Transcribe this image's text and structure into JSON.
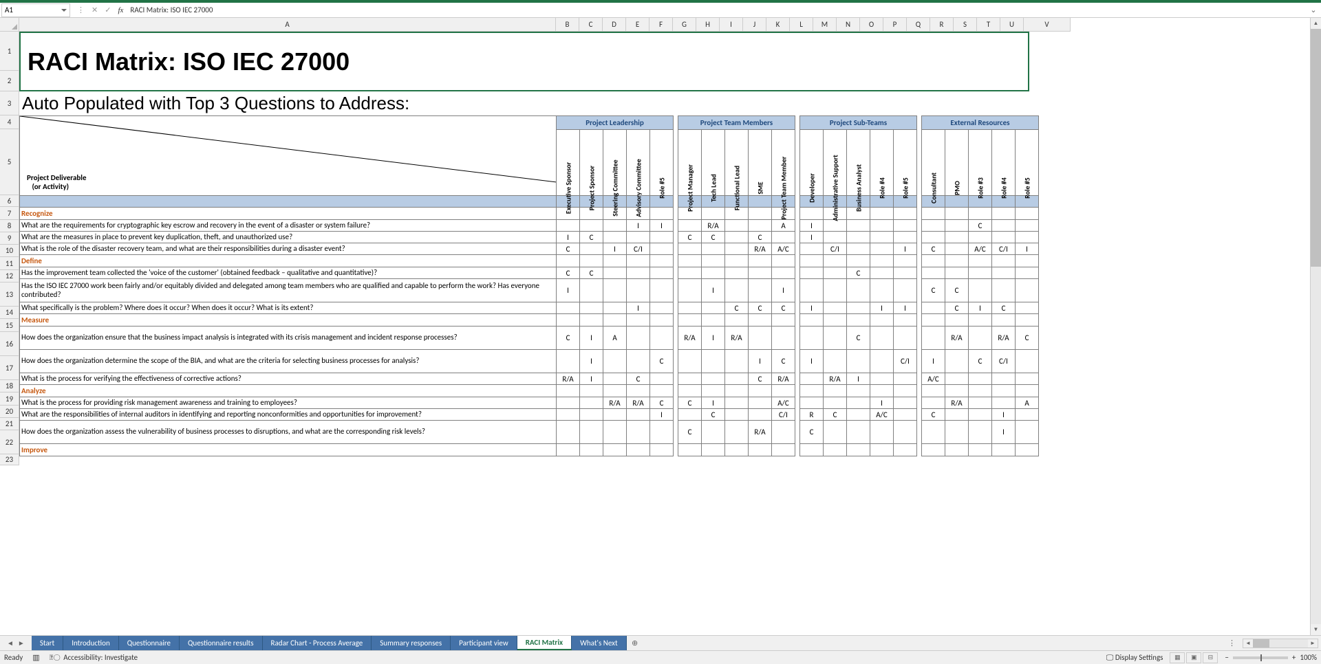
{
  "namebox": "A1",
  "formula": "RACI Matrix: ISO IEC 27000",
  "columns": [
    "A",
    "B",
    "C",
    "D",
    "E",
    "F",
    "G",
    "H",
    "I",
    "J",
    "K",
    "L",
    "M",
    "N",
    "O",
    "P",
    "Q",
    "R",
    "S",
    "T",
    "U",
    "V"
  ],
  "row_nums": [
    "1",
    "2",
    "3",
    "4",
    "5",
    "6",
    "7",
    "8",
    "9",
    "10",
    "11",
    "12",
    "13",
    "14",
    "15",
    "16",
    "17",
    "18",
    "19",
    "20",
    "21",
    "22",
    "23"
  ],
  "title": "RACI Matrix: ISO IEC 27000",
  "subtitle": "Auto Populated with Top 3 Questions to Address:",
  "groups": [
    "Project Leadership",
    "Project Team Members",
    "Project Sub-Teams",
    "External Resources"
  ],
  "roles": [
    "Executive Sponsor",
    "Project Sponsor",
    "Steering Committee",
    "Advisory Committee",
    "Role #5",
    "Project Manager",
    "Tech Lead",
    "Functional Lead",
    "SME",
    "Project Team Member",
    "Developer",
    "Administrative Support",
    "Business Analyst",
    "Role #4",
    "Role #5",
    "Consultant",
    "PMO",
    "Role #3",
    "Role #4",
    "Role #5"
  ],
  "deliv_label_1": "Project Deliverable",
  "deliv_label_2": "(or Activity)",
  "phases": {
    "recognize": "Recognize",
    "define": "Define",
    "measure": "Measure",
    "analyze": "Analyze",
    "improve": "Improve"
  },
  "rows": [
    {
      "q": "What are the requirements for cryptographic key escrow and recovery in the event of a disaster or system failure?",
      "v": [
        "",
        "",
        "",
        "I",
        "I",
        "",
        "R/A",
        "",
        "",
        "A",
        "I",
        "",
        "",
        "",
        "",
        "",
        "",
        "C",
        "",
        ""
      ]
    },
    {
      "q": "What are the measures in place to prevent key duplication, theft, and unauthorized use?",
      "v": [
        "I",
        "C",
        "",
        "",
        "",
        "C",
        "C",
        "",
        "C",
        "",
        "I",
        "",
        "",
        "",
        "",
        "",
        "",
        "",
        "",
        ""
      ]
    },
    {
      "q": "What is the role of the disaster recovery team, and what are their responsibilities during a disaster event?",
      "v": [
        "C",
        "",
        "I",
        "C/I",
        "",
        "",
        "",
        "",
        "R/A",
        "A/C",
        "",
        "C/I",
        "",
        "",
        "I",
        "C",
        "",
        "A/C",
        "C/I",
        "I"
      ]
    },
    {
      "q": "Has the improvement team collected the 'voice of the customer' (obtained feedback – qualitative and quantitative)?",
      "v": [
        "C",
        "C",
        "",
        "",
        "",
        "",
        "",
        "",
        "",
        "",
        "",
        "",
        "C",
        "",
        "",
        "",
        "",
        "",
        "",
        ""
      ]
    },
    {
      "q": "Has the ISO IEC 27000 work been fairly and/or equitably divided and delegated among team members who are qualified and capable to perform the work? Has everyone contributed?",
      "v": [
        "I",
        "",
        "",
        "",
        "",
        "",
        "I",
        "",
        "",
        "I",
        "",
        "",
        "",
        "",
        "",
        "C",
        "C",
        "",
        "",
        ""
      ]
    },
    {
      "q": "What specifically is the problem? Where does it occur? When does it occur? What is its extent?",
      "v": [
        "",
        "",
        "",
        "I",
        "",
        "",
        "",
        "C",
        "C",
        "C",
        "I",
        "",
        "",
        "I",
        "I",
        "",
        "C",
        "I",
        "C",
        ""
      ]
    },
    {
      "q": "How does the organization ensure that the business impact analysis is integrated with its crisis management and incident response processes?",
      "v": [
        "C",
        "I",
        "A",
        "",
        "",
        "R/A",
        "I",
        "R/A",
        "",
        "",
        "",
        "",
        "C",
        "",
        "",
        "",
        "R/A",
        "",
        "R/A",
        "C"
      ]
    },
    {
      "q": "How does the organization determine the scope of the BIA, and what are the criteria for selecting business processes for analysis?",
      "v": [
        "",
        "I",
        "",
        "",
        "C",
        "",
        "",
        "",
        "I",
        "C",
        "I",
        "",
        "",
        "",
        "C/I",
        "I",
        "",
        "C",
        "C/I",
        ""
      ]
    },
    {
      "q": "What is the process for verifying the effectiveness of corrective actions?",
      "v": [
        "R/A",
        "I",
        "",
        "C",
        "",
        "",
        "",
        "",
        "C",
        "R/A",
        "",
        "R/A",
        "I",
        "",
        "",
        "A/C",
        "",
        "",
        "",
        ""
      ]
    },
    {
      "q": "What is the process for providing risk management awareness and training to employees?",
      "v": [
        "",
        "",
        "R/A",
        "R/A",
        "C",
        "C",
        "I",
        "",
        "",
        "A/C",
        "",
        "",
        "",
        "I",
        "",
        "",
        "R/A",
        "",
        "",
        "A"
      ]
    },
    {
      "q": "What are the responsibilities of internal auditors in identifying and reporting nonconformities and opportunities for improvement?",
      "v": [
        "",
        "",
        "",
        "",
        "I",
        "",
        "C",
        "",
        "",
        "C/I",
        "R",
        "C",
        "",
        "A/C",
        "",
        "C",
        "",
        "",
        "I",
        ""
      ]
    },
    {
      "q": "How does the organization assess the vulnerability of business processes to disruptions, and what are the corresponding risk levels?",
      "v": [
        "",
        "",
        "",
        "",
        "",
        "C",
        "",
        "",
        "R/A",
        "",
        "C",
        "",
        "",
        "",
        "",
        "",
        "",
        "",
        "I",
        ""
      ]
    }
  ],
  "sheet_tabs": [
    "Start",
    "Introduction",
    "Questionnaire",
    "Questionnaire results",
    "Radar Chart - Process Average",
    "Summary responses",
    "Participant view",
    "RACI Matrix",
    "What's Next"
  ],
  "active_tab": "RACI Matrix",
  "status": {
    "ready": "Ready",
    "acc": "Accessibility: Investigate",
    "display": "Display Settings",
    "zoom": "100%"
  }
}
